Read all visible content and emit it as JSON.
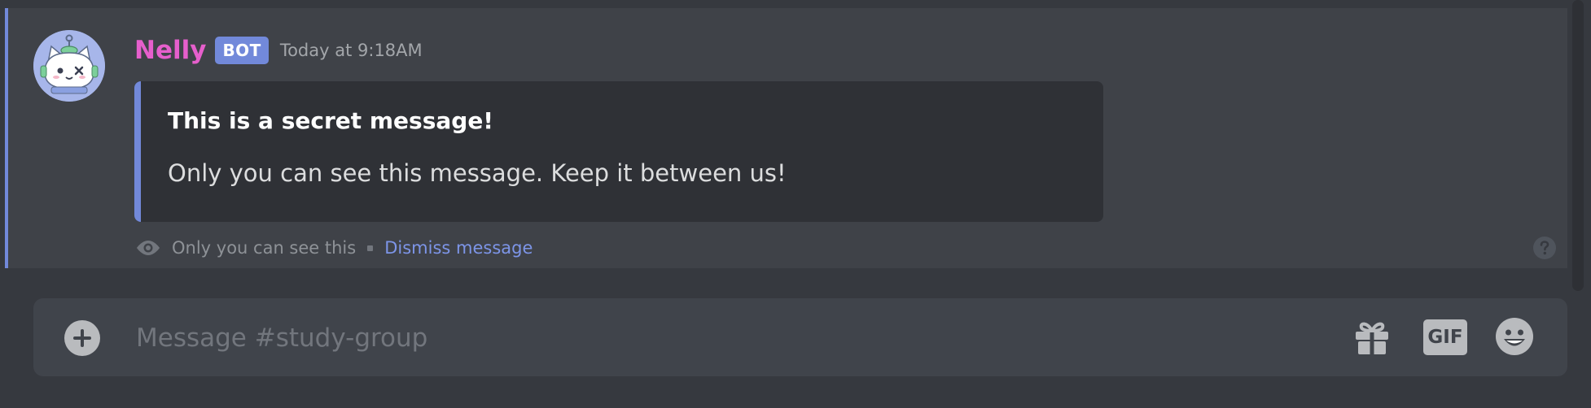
{
  "message": {
    "username": "Nelly",
    "bot_tag": "BOT",
    "timestamp": "Today at 9:18AM",
    "embed": {
      "title": "This is a secret message!",
      "description": "Only you can see this message. Keep it between us!"
    },
    "footer": {
      "visibility_text": "Only you can see this",
      "dismiss_label": "Dismiss message"
    }
  },
  "composer": {
    "placeholder": "Message #study-group",
    "gift_icon": "gift-icon",
    "gif_label": "GIF",
    "emoji_icon": "emoji-icon"
  },
  "colors": {
    "background": "#36393f",
    "ephemeral_bg": "#3f4248",
    "accent": "#7289da",
    "username": "#e65fcc",
    "link": "#7d95e8"
  }
}
